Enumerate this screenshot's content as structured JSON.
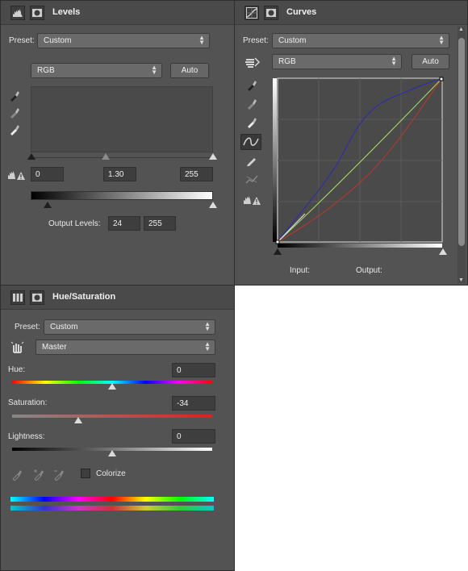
{
  "levels": {
    "title": "Levels",
    "preset_label": "Preset:",
    "preset_value": "Custom",
    "channel_value": "RGB",
    "auto_label": "Auto",
    "input_black": "0",
    "input_gamma": "1.30",
    "input_white": "255",
    "output_label": "Output Levels:",
    "output_black": "24",
    "output_white": "255",
    "icons": [
      "levels-panel-icon",
      "mask-icon",
      "black-eyedropper-icon",
      "gray-eyedropper-icon",
      "white-eyedropper-icon",
      "clip-warning-icon"
    ]
  },
  "curves": {
    "title": "Curves",
    "preset_label": "Preset:",
    "preset_value": "Custom",
    "channel_value": "RGB",
    "auto_label": "Auto",
    "input_label": "Input:",
    "output_label": "Output:",
    "icons": [
      "curves-panel-icon",
      "mask-icon",
      "target-adjust-icon",
      "black-eyedropper-icon",
      "gray-eyedropper-icon",
      "white-eyedropper-icon",
      "curve-point-icon",
      "pencil-icon",
      "smooth-icon",
      "clip-warning-icon"
    ],
    "colors": {
      "red": "#c0362c",
      "green": "#a8e060",
      "blue": "#2b2bb0",
      "rgb": "#e8e8e8"
    }
  },
  "hue_saturation": {
    "title": "Hue/Saturation",
    "preset_label": "Preset:",
    "preset_value": "Custom",
    "range_value": "Master",
    "hue_label": "Hue:",
    "hue_value": "0",
    "saturation_label": "Saturation:",
    "saturation_value": "-34",
    "lightness_label": "Lightness:",
    "lightness_value": "0",
    "colorize_label": "Colorize",
    "colorize_checked": false,
    "icons": [
      "hue-saturation-panel-icon",
      "mask-icon",
      "target-adjust-icon",
      "eyedropper-icon",
      "eyedropper-add-icon",
      "eyedropper-subtract-icon"
    ]
  }
}
